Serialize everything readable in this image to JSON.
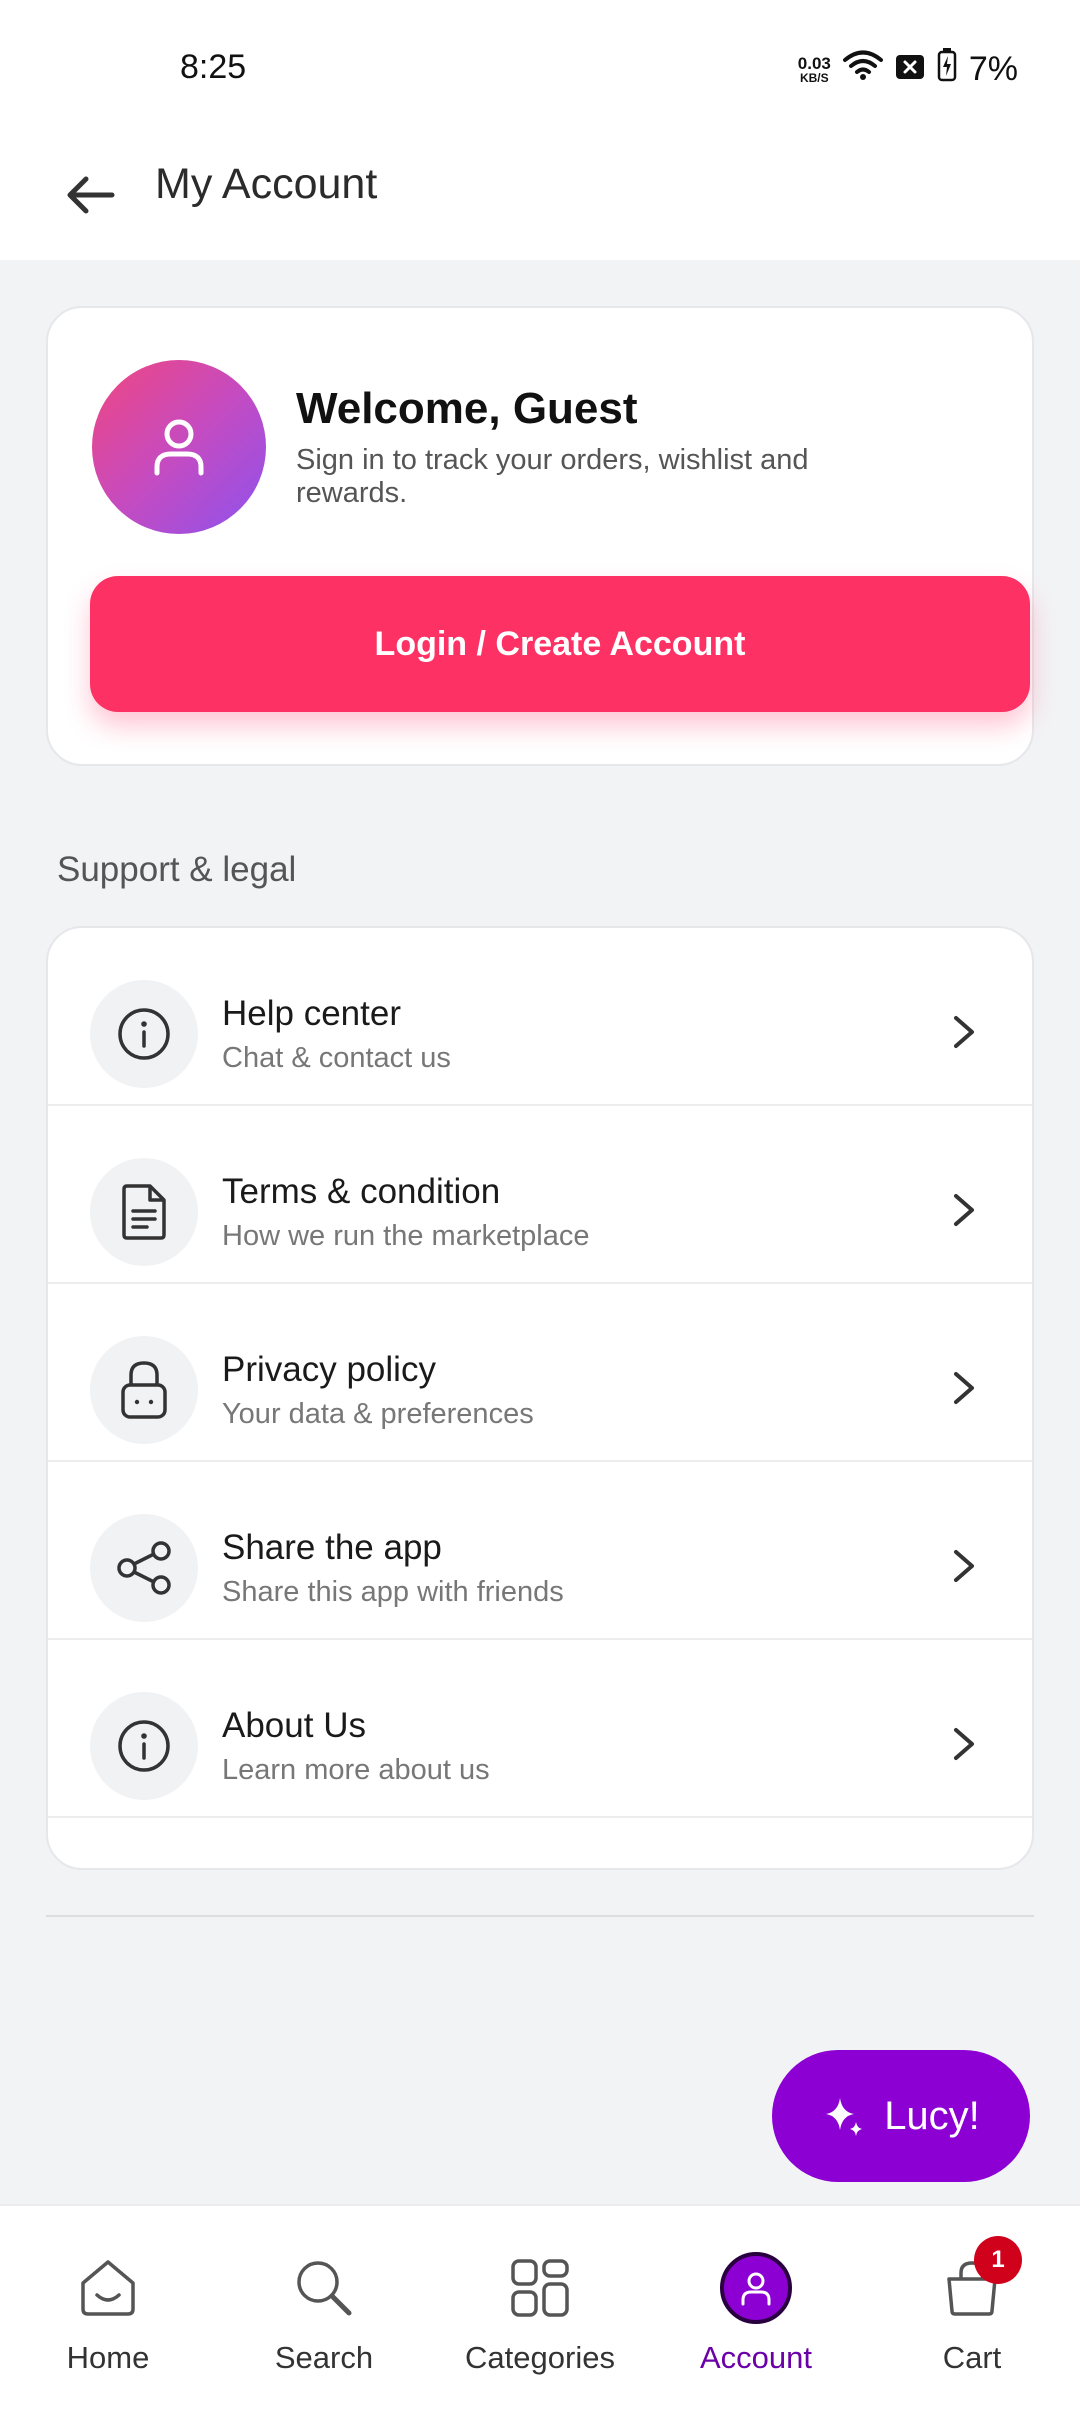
{
  "status_bar": {
    "time": "8:25",
    "net_speed_value": "0.03",
    "net_speed_unit": "KB/S",
    "battery": "7%"
  },
  "header": {
    "title": "My Account"
  },
  "welcome": {
    "title": "Welcome, Guest",
    "subtitle": "Sign in to track your orders, wishlist and rewards.",
    "login_label": "Login / Create Account"
  },
  "support": {
    "section_title": "Support & legal",
    "items": [
      {
        "title": "Help center",
        "subtitle": "Chat & contact us",
        "icon": "info-icon"
      },
      {
        "title": "Terms & condition",
        "subtitle": "How we run the marketplace",
        "icon": "document-icon"
      },
      {
        "title": "Privacy policy",
        "subtitle": "Your data & preferences",
        "icon": "lock-icon"
      },
      {
        "title": "Share the app",
        "subtitle": "Share this app with friends",
        "icon": "share-icon"
      },
      {
        "title": "About Us",
        "subtitle": "Learn more about us",
        "icon": "info-icon"
      }
    ]
  },
  "fab": {
    "label": "Lucy!"
  },
  "bottom_nav": {
    "items": [
      {
        "label": "Home",
        "icon": "home-icon"
      },
      {
        "label": "Search",
        "icon": "search-icon"
      },
      {
        "label": "Categories",
        "icon": "grid-icon"
      },
      {
        "label": "Account",
        "icon": "user-icon",
        "active": true
      },
      {
        "label": "Cart",
        "icon": "cart-icon",
        "badge": "1"
      }
    ]
  },
  "colors": {
    "accent": "#fe3165",
    "brand_purple": "#8c00d4",
    "badge": "#d0021b"
  }
}
